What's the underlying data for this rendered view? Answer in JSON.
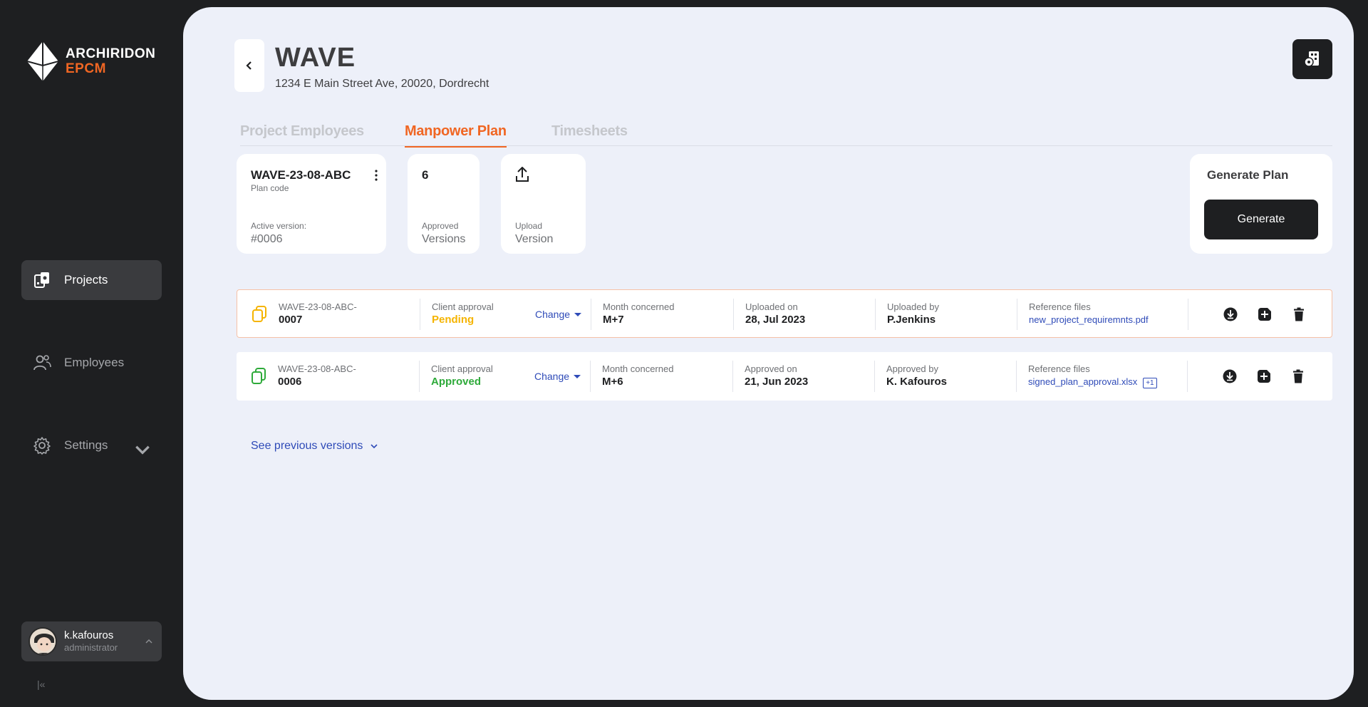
{
  "brand": {
    "line1": "ARCHIRIDON",
    "line2": "EPCM",
    "accent": "#f06623"
  },
  "sidebar": {
    "items": [
      {
        "label": "Projects",
        "icon": "projects-icon",
        "active": true
      },
      {
        "label": "Employees",
        "icon": "employees-icon",
        "active": false
      },
      {
        "label": "Settings",
        "icon": "gear-icon",
        "active": false
      }
    ],
    "user": {
      "name": "k.kafouros",
      "role": "administrator"
    },
    "collapse_label": "|«"
  },
  "project": {
    "title": "WAVE",
    "address": "1234 E Main Street Ave, 20020,  Dordrecht"
  },
  "tabs": [
    {
      "label": "Project Employees",
      "active": false
    },
    {
      "label": "Manpower Plan",
      "active": true
    },
    {
      "label": "Timesheets",
      "active": false
    }
  ],
  "summary": {
    "plan_code": "WAVE-23-08-ABC",
    "plan_code_label": "Plan code",
    "active_version_label": "Active version:",
    "active_version_value": "#0006",
    "approved_count": "6",
    "approved_label": "Approved",
    "approved_sub": "Versions",
    "upload_label": "Upload",
    "upload_sub": "Version",
    "generate_title": "Generate Plan",
    "generate_button": "Generate"
  },
  "versions": [
    {
      "prefix": "WAVE-23-08-ABC-",
      "number": "0007",
      "approval_label": "Client approval",
      "approval_status": "Pending",
      "change_label": "Change",
      "month_label": "Month concerned",
      "month_value": "M+7",
      "date_label": "Uploaded on",
      "date_value": "28, Jul 2023",
      "by_label": "Uploaded by",
      "by_value": "P.Jenkins",
      "files_label": "Reference files",
      "file_name": "new_project_requiremnts.pdf",
      "extra_files": ""
    },
    {
      "prefix": "WAVE-23-08-ABC-",
      "number": "0006",
      "approval_label": "Client approval",
      "approval_status": "Approved",
      "change_label": "Change",
      "month_label": "Month concerned",
      "month_value": "M+6",
      "date_label": "Approved on",
      "date_value": "21, Jun 2023",
      "by_label": "Approved by",
      "by_value": "K. Kafouros",
      "files_label": "Reference files",
      "file_name": "signed_plan_approval.xlsx",
      "extra_files": "+1"
    }
  ],
  "see_previous": "See previous versions",
  "colors": {
    "pending": "#f5b400",
    "approved": "#2eaa3a",
    "link": "#2f4bb8",
    "background": "#edf0f9",
    "sidebar": "#1e1f21"
  }
}
